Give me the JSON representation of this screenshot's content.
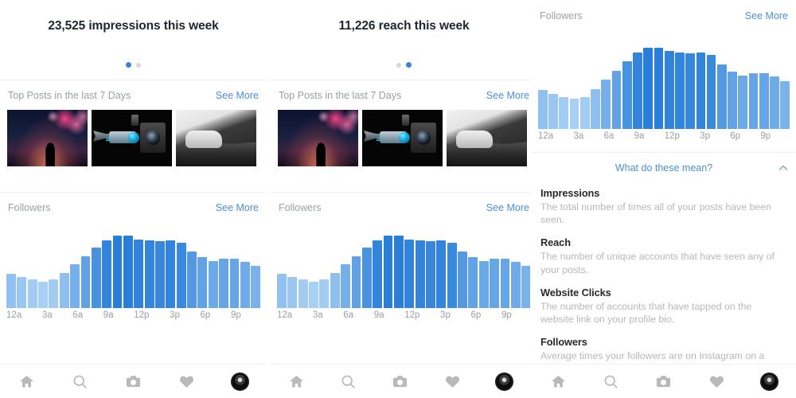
{
  "colors": {
    "link": "#4a90d9",
    "muted": "#9aa0a6",
    "bar_light": "#a8d0f5",
    "bar_dark": "#2e86de",
    "dot_active": "#3a83d6",
    "dot_inactive": "#d4d8dd",
    "text": "#26292c"
  },
  "panels": [
    {
      "id": "impressions-panel",
      "headline": "23,525 impressions this week",
      "dots": [
        {
          "active": true
        },
        {
          "active": false
        }
      ],
      "top_posts": {
        "title": "Top Posts in the last 7 Days",
        "see_more": "See More"
      },
      "thumbnails": [
        {
          "name": "fireworks-couple-photo"
        },
        {
          "name": "camera-blue-lens-photo"
        },
        {
          "name": "black-white-feet-rock-photo"
        }
      ],
      "followers": {
        "title": "Followers",
        "see_more": "See More"
      }
    },
    {
      "id": "reach-panel",
      "headline": "11,226 reach this week",
      "dots": [
        {
          "active": false
        },
        {
          "active": true
        }
      ],
      "top_posts": {
        "title": "Top Posts in the last 7 Days",
        "see_more": "See More"
      },
      "thumbnails": [
        {
          "name": "fireworks-couple-photo"
        },
        {
          "name": "camera-blue-lens-photo"
        },
        {
          "name": "black-white-feet-rock-photo"
        }
      ],
      "followers": {
        "title": "Followers",
        "see_more": "See More"
      }
    },
    {
      "id": "definitions-panel",
      "followers": {
        "title": "Followers",
        "see_more": "See More"
      },
      "expander": {
        "label": "What do these mean?",
        "icon": "chevron-up-icon",
        "expanded": true
      },
      "definitions": [
        {
          "term": "Impressions",
          "desc": "The total number of times all of your posts have been seen."
        },
        {
          "term": "Reach",
          "desc": "The number of unique accounts that have seen any of your posts."
        },
        {
          "term": "Website Clicks",
          "desc": "The number of accounts that have tapped on the website link on your profile bio."
        },
        {
          "term": "Followers",
          "desc": "Average times your followers are on Instagram on a typical day."
        }
      ]
    }
  ],
  "nav": {
    "items": [
      {
        "name": "home-icon",
        "label": "Home"
      },
      {
        "name": "search-icon",
        "label": "Search"
      },
      {
        "name": "camera-icon",
        "label": "Camera"
      },
      {
        "name": "heart-icon",
        "label": "Activity"
      },
      {
        "name": "profile-avatar",
        "label": "Profile"
      }
    ]
  },
  "chart_data": {
    "type": "bar",
    "title": "Followers",
    "subtitle": "Average times your followers are on Instagram on a typical day",
    "xlabel": "",
    "ylabel": "",
    "grid": false,
    "legend": null,
    "x": [
      "12a",
      "1a",
      "2a",
      "3a",
      "4a",
      "5a",
      "6a",
      "7a",
      "8a",
      "9a",
      "10a",
      "11a",
      "12p",
      "1p",
      "2p",
      "3p",
      "4p",
      "5p",
      "6p",
      "7p",
      "8p",
      "9p",
      "10p",
      "11p"
    ],
    "tick_labels": [
      "12a",
      "",
      "",
      "3a",
      "",
      "",
      "6a",
      "",
      "",
      "9a",
      "",
      "",
      "12p",
      "",
      "",
      "3p",
      "",
      "",
      "6p",
      "",
      "",
      "9p",
      "",
      ""
    ],
    "values": [
      40,
      36,
      33,
      31,
      33,
      41,
      51,
      60,
      70,
      79,
      84,
      84,
      80,
      79,
      78,
      79,
      76,
      66,
      59,
      55,
      57,
      57,
      54,
      49
    ],
    "ylim": [
      0,
      100
    ],
    "value_unit": "relative activity"
  }
}
